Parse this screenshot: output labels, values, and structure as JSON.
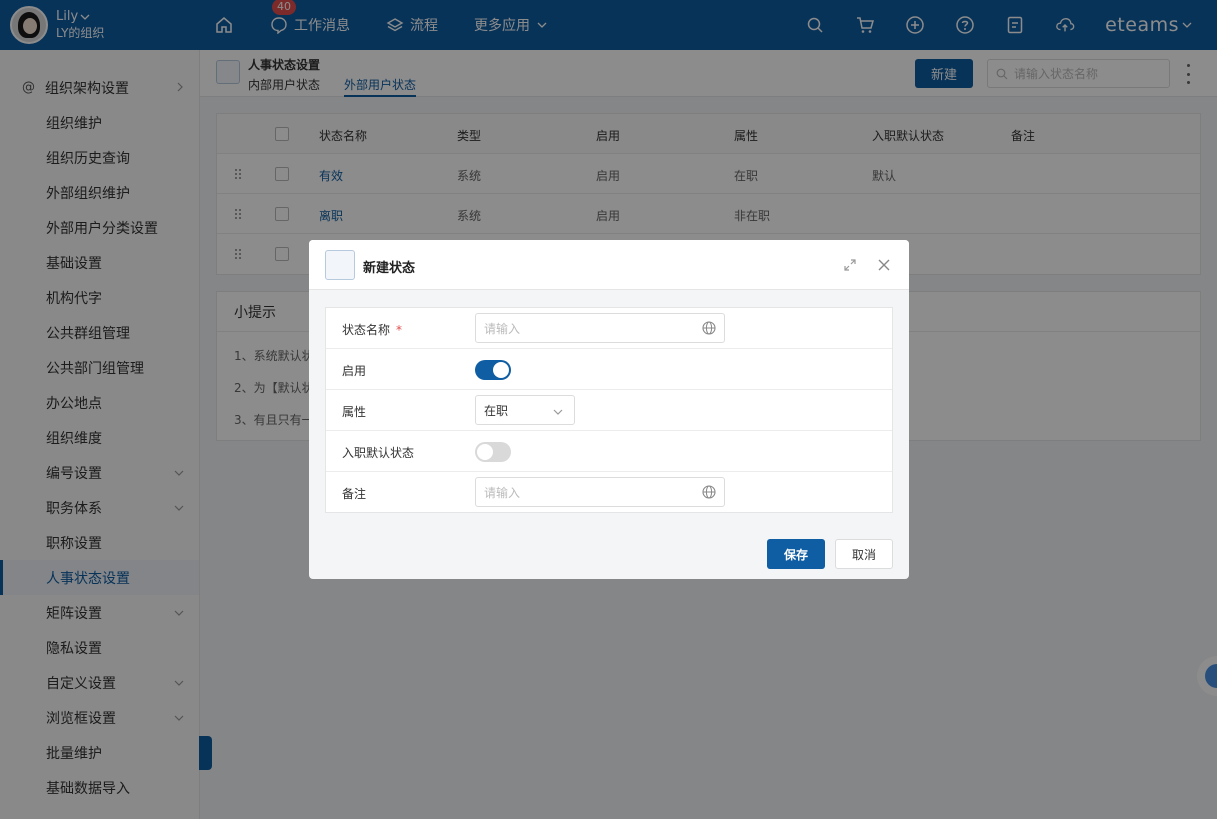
{
  "user": {
    "name": "Lily",
    "org": "LY的组织"
  },
  "topnav": {
    "messages_label": "工作消息",
    "messages_badge": "40",
    "flow_label": "流程",
    "more_apps_label": "更多应用",
    "brand": "eteams"
  },
  "sidebar": {
    "items": [
      {
        "label": "组织架构设置"
      },
      {
        "label": "组织维护"
      },
      {
        "label": "组织历史查询"
      },
      {
        "label": "外部组织维护"
      },
      {
        "label": "外部用户分类设置"
      },
      {
        "label": "基础设置"
      },
      {
        "label": "机构代字"
      },
      {
        "label": "公共群组管理"
      },
      {
        "label": "公共部门组管理"
      },
      {
        "label": "办公地点"
      },
      {
        "label": "组织维度"
      },
      {
        "label": "编号设置"
      },
      {
        "label": "职务体系"
      },
      {
        "label": "职称设置"
      },
      {
        "label": "人事状态设置"
      },
      {
        "label": "矩阵设置"
      },
      {
        "label": "隐私设置"
      },
      {
        "label": "自定义设置"
      },
      {
        "label": "浏览框设置"
      },
      {
        "label": "批量维护"
      },
      {
        "label": "基础数据导入"
      }
    ]
  },
  "page": {
    "title": "人事状态设置",
    "tabs": [
      "内部用户状态",
      "外部用户状态"
    ],
    "new_button": "新建",
    "search_placeholder": "请输入状态名称"
  },
  "table": {
    "headers": [
      "状态名称",
      "类型",
      "启用",
      "属性",
      "入职默认状态",
      "备注"
    ],
    "rows": [
      [
        "有效",
        "系统",
        "启用",
        "在职",
        "默认",
        ""
      ],
      [
        "离职",
        "系统",
        "启用",
        "非在职",
        "",
        ""
      ],
      [
        "",
        "",
        "",
        "",
        "",
        ""
      ]
    ]
  },
  "tips": {
    "title": "小提示",
    "lines": [
      "1、系统默认状",
      "2、为【默认状",
      "3、有且只有一"
    ]
  },
  "modal": {
    "title": "新建状态",
    "fields": {
      "name_label": "状态名称",
      "name_required": "*",
      "name_placeholder": "请输入",
      "enable_label": "启用",
      "enable_on": true,
      "attr_label": "属性",
      "attr_value": "在职",
      "default_label": "入职默认状态",
      "default_on": false,
      "note_label": "备注",
      "note_placeholder": "请输入"
    },
    "save": "保存",
    "cancel": "取消"
  },
  "colors": {
    "primary": "#0f5da2",
    "badge": "#e34d4d"
  }
}
